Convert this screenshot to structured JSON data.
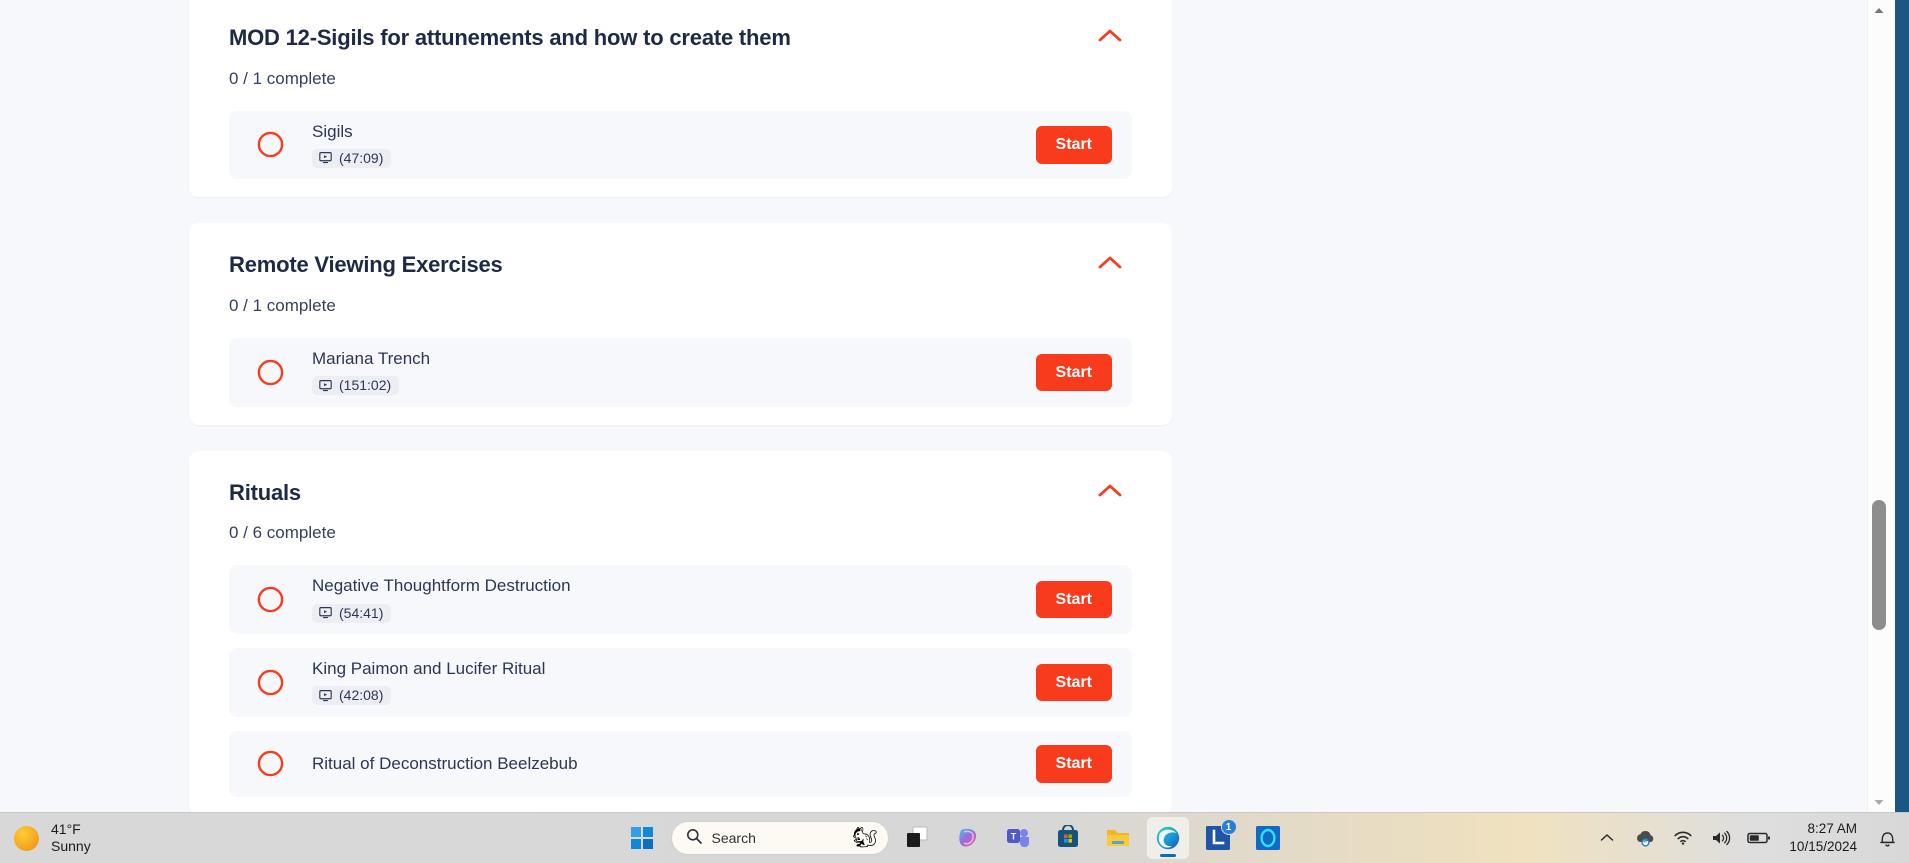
{
  "page": {
    "background": "#f7f8fc",
    "accent_red": "#f93b1d",
    "heading_color": "#1e2a45"
  },
  "sections": [
    {
      "title": "MOD 12-Sigils for attunements and how to create them",
      "progress": "0 / 1 complete",
      "collapse_icon": "chevron-up-icon",
      "lessons": [
        {
          "title": "Sigils",
          "duration": "(47:09)",
          "media_icon": "video-screen-icon",
          "action": "Start",
          "status_icon": "circle-incomplete-icon"
        }
      ]
    },
    {
      "title": "Remote Viewing Exercises",
      "progress": "0 / 1 complete",
      "collapse_icon": "chevron-up-icon",
      "lessons": [
        {
          "title": "Mariana Trench",
          "duration": "(151:02)",
          "media_icon": "video-screen-icon",
          "action": "Start",
          "status_icon": "circle-incomplete-icon"
        }
      ]
    },
    {
      "title": "Rituals",
      "progress": "0 / 6 complete",
      "collapse_icon": "chevron-up-icon",
      "lessons": [
        {
          "title": "Negative Thoughtform Destruction",
          "duration": "(54:41)",
          "media_icon": "video-screen-icon",
          "action": "Start",
          "status_icon": "circle-incomplete-icon"
        },
        {
          "title": "King Paimon and Lucifer Ritual",
          "duration": "(42:08)",
          "media_icon": "video-screen-icon",
          "action": "Start",
          "status_icon": "circle-incomplete-icon"
        },
        {
          "title": "Ritual of Deconstruction Beelzebub",
          "duration": "",
          "media_icon": "video-screen-icon",
          "action": "Start",
          "status_icon": "circle-incomplete-icon"
        }
      ]
    }
  ],
  "taskbar": {
    "weather": {
      "temperature": "41°F",
      "condition": "Sunny",
      "icon": "sun-icon"
    },
    "start_icon": "windows-start-icon",
    "search": {
      "placeholder": "Search",
      "icon": "search-icon",
      "widget_icon": "squirrel-icon"
    },
    "apps": [
      {
        "name": "task-view",
        "icon": "task-view-icon",
        "label": ""
      },
      {
        "name": "copilot",
        "icon": "copilot-icon",
        "label": ""
      },
      {
        "name": "teams",
        "icon": "teams-icon",
        "label": "T"
      },
      {
        "name": "microsoft-store",
        "icon": "store-icon",
        "label": ""
      },
      {
        "name": "file-explorer",
        "icon": "folder-icon",
        "label": ""
      },
      {
        "name": "edge",
        "icon": "edge-icon",
        "label": "",
        "active": true
      },
      {
        "name": "app-l",
        "icon": "l-app-icon",
        "label": "L",
        "badge": "1"
      },
      {
        "name": "app-circle",
        "icon": "teal-circle-icon",
        "label": ""
      }
    ],
    "tray": [
      {
        "name": "show-hidden-icons",
        "icon": "chevron-up-icon"
      },
      {
        "name": "onedrive",
        "icon": "cloud-sync-icon"
      },
      {
        "name": "network",
        "icon": "wifi-icon"
      },
      {
        "name": "volume",
        "icon": "speaker-icon"
      },
      {
        "name": "battery",
        "icon": "battery-icon"
      }
    ],
    "clock": {
      "time": "8:27 AM",
      "date": "10/15/2024"
    },
    "notifications_icon": "bell-icon"
  },
  "scrollbar": {
    "up_icon": "caret-up-icon",
    "down_icon": "caret-down-icon",
    "thumb_position_percent": 62
  }
}
